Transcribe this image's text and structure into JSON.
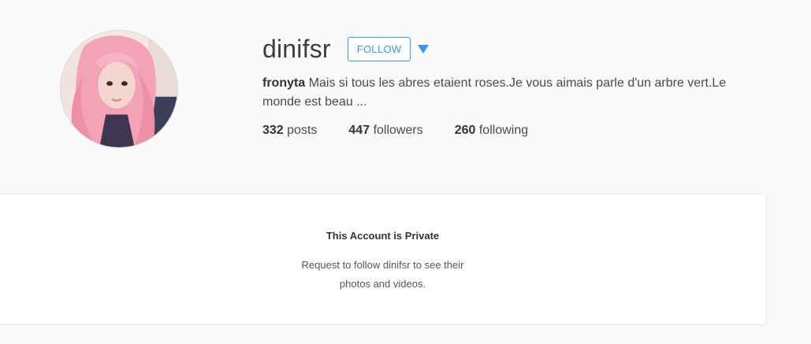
{
  "profile": {
    "username": "dinifsr",
    "follow_label": "FOLLOW",
    "full_name": "fronyta",
    "bio": "Mais si tous les abres etaient roses.Je vous aimais parle d'un arbre vert.Le monde est beau ...",
    "stats": {
      "posts_count": "332",
      "posts_label": "posts",
      "followers_count": "447",
      "followers_label": "followers",
      "following_count": "260",
      "following_label": "following"
    }
  },
  "private": {
    "title": "This Account is Private",
    "message": "Request to follow dinifsr to see their photos and videos."
  },
  "colors": {
    "accent": "#3897f0",
    "background": "#fafafa",
    "panel": "#ffffff"
  }
}
